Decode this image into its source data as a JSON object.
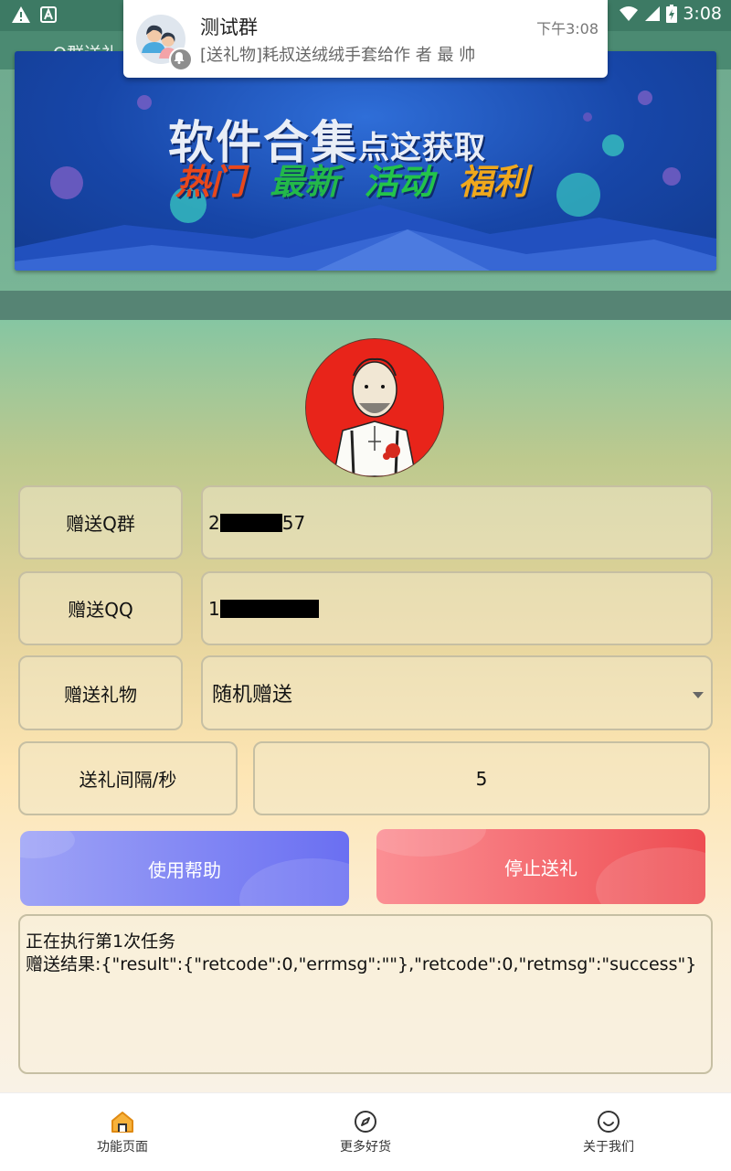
{
  "status_bar": {
    "time": "3:08",
    "icons": [
      "warning-icon",
      "a-icon",
      "wifi-icon",
      "signal-icon",
      "battery-icon"
    ]
  },
  "app_bar": {
    "title": "Q群送礼"
  },
  "notification": {
    "title": "测试群",
    "time": "下午3:08",
    "text": "[送礼物]耗叔送绒绒手套给作 者 最 帅"
  },
  "banner": {
    "title_big": "软件合集",
    "title_small": "点这获取",
    "tags": [
      {
        "text": "热门",
        "color": "#e8481c"
      },
      {
        "text": "最新",
        "color": "#23b84a"
      },
      {
        "text": "活动",
        "color": "#23c44a"
      },
      {
        "text": "福利",
        "color": "#f0a81c"
      }
    ]
  },
  "form": {
    "group_label": "赠送Q群",
    "group_value_prefix": "2",
    "group_value_suffix": "57",
    "qq_label": "赠送QQ",
    "qq_value_prefix": "1",
    "gift_label": "赠送礼物",
    "gift_value": "随机赠送",
    "interval_label": "送礼间隔/秒",
    "interval_value": "5"
  },
  "buttons": {
    "help": "使用帮助",
    "stop": "停止送礼"
  },
  "log": {
    "line1": "正在执行第1次任务",
    "line2": "赠送结果:{\"result\":{\"retcode\":0,\"errmsg\":\"\"},\"retcode\":0,\"retmsg\":\"success\"}"
  },
  "bottom_nav": [
    {
      "label": "功能页面",
      "icon": "home-icon",
      "active": true
    },
    {
      "label": "更多好货",
      "icon": "compass-icon",
      "active": false
    },
    {
      "label": "关于我们",
      "icon": "smile-icon",
      "active": false
    }
  ],
  "colors": {
    "accent_help": "#6a6ff2",
    "accent_stop": "#ee4d52",
    "status_bar": "#3d7a64"
  }
}
